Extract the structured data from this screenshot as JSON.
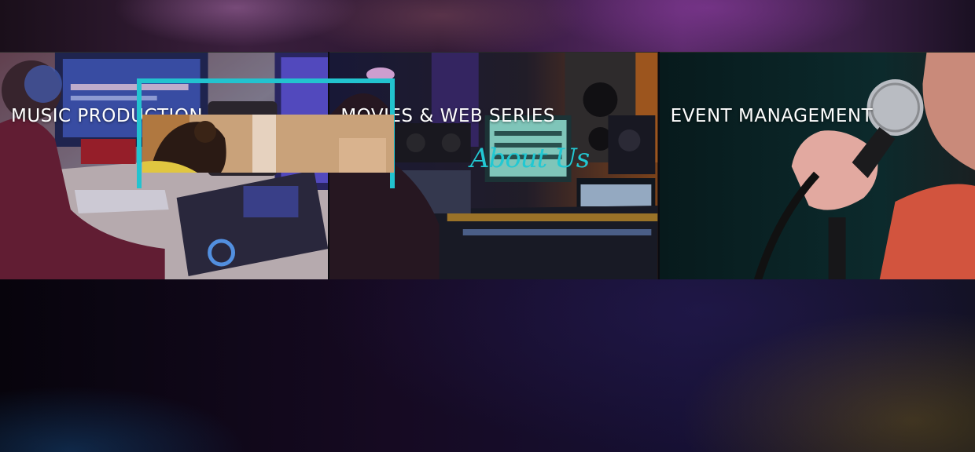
{
  "services": [
    {
      "title": "MUSIC PRODUCTION"
    },
    {
      "title": "MOVIES & WEB SERIES"
    },
    {
      "title": "EVENT MANAGEMENT"
    }
  ],
  "about": {
    "heading": "About Us"
  },
  "colors": {
    "accent": "#22c3cf",
    "background": "#0c0718",
    "card_text": "#ffffff"
  }
}
